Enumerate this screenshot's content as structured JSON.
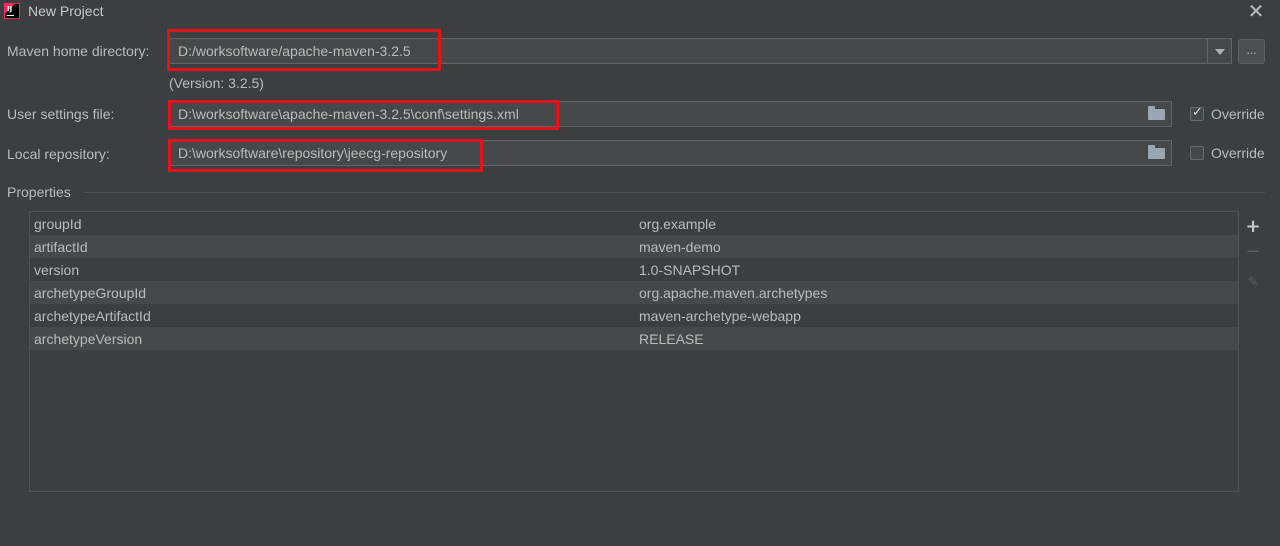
{
  "window": {
    "title": "New Project",
    "app_icon_text": "IJ"
  },
  "maven_home": {
    "label": "Maven home directory:",
    "value": "D:/worksoftware/apache-maven-3.2.5",
    "version_hint": "(Version: 3.2.5)",
    "browse_label": "..."
  },
  "user_settings": {
    "label": "User settings file:",
    "value": "D:\\worksoftware\\apache-maven-3.2.5\\conf\\settings.xml",
    "override_label": "Override",
    "override_checked": true
  },
  "local_repo": {
    "label": "Local repository:",
    "value": "D:\\worksoftware\\repository\\jeecg-repository",
    "override_label": "Override",
    "override_checked": false
  },
  "properties": {
    "title": "Properties",
    "rows": [
      {
        "key": "groupId",
        "value": "org.example"
      },
      {
        "key": "artifactId",
        "value": "maven-demo"
      },
      {
        "key": "version",
        "value": "1.0-SNAPSHOT"
      },
      {
        "key": "archetypeGroupId",
        "value": "org.apache.maven.archetypes"
      },
      {
        "key": "archetypeArtifactId",
        "value": "maven-archetype-webapp"
      },
      {
        "key": "archetypeVersion",
        "value": "RELEASE"
      }
    ],
    "tools": {
      "add": "+",
      "remove": "−",
      "edit": "✎"
    }
  },
  "colors": {
    "background": "#3c3f41",
    "field_bg": "#45494a",
    "highlight_border": "#e2131b",
    "text": "#bbbbbb"
  },
  "icons": [
    "intellij-app-icon",
    "close-icon",
    "chevron-down-icon",
    "folder-icon",
    "checkmark-icon",
    "plus-icon",
    "minus-icon",
    "pencil-icon"
  ]
}
